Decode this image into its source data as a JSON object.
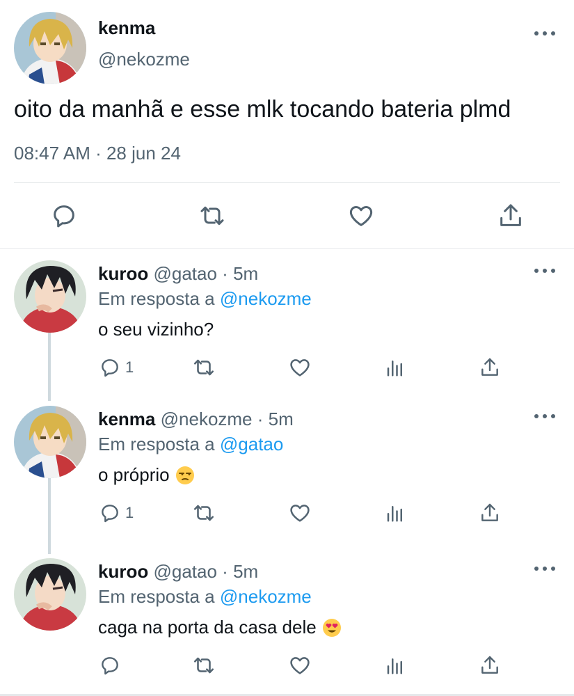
{
  "main_tweet": {
    "name": "kenma",
    "handle": "@nekozme",
    "text": "oito da manhã e esse mlk tocando bateria plmd",
    "timestamp": "08:47 AM · 28 jun 24",
    "actions": [
      "reply-icon",
      "retweet-icon",
      "like-icon",
      "share-icon"
    ]
  },
  "replies": [
    {
      "name": "kuroo",
      "handle": "@gatao",
      "dot": "·",
      "time": "5m",
      "reply_prefix": "Em resposta a",
      "reply_to": "@nekozme",
      "text": "o seu vizinho?",
      "emoji": "",
      "reply_count": "1",
      "avatar": "black-hair"
    },
    {
      "name": "kenma",
      "handle": "@nekozme",
      "dot": "·",
      "time": "5m",
      "reply_prefix": "Em resposta a",
      "reply_to": "@gatao",
      "text": "o próprio",
      "emoji": "unamused-face",
      "reply_count": "1",
      "avatar": "blonde-hair"
    },
    {
      "name": "kuroo",
      "handle": "@gatao",
      "dot": "·",
      "time": "5m",
      "reply_prefix": "Em resposta a",
      "reply_to": "@nekozme",
      "text": "caga na porta da casa dele",
      "emoji": "heart-eyes-face",
      "reply_count": "",
      "avatar": "black-hair"
    }
  ],
  "colors": {
    "link": "#1d9bf0",
    "secondary_text": "#536471",
    "divider": "#e6e9eb",
    "thread_line": "#cfd9de"
  }
}
